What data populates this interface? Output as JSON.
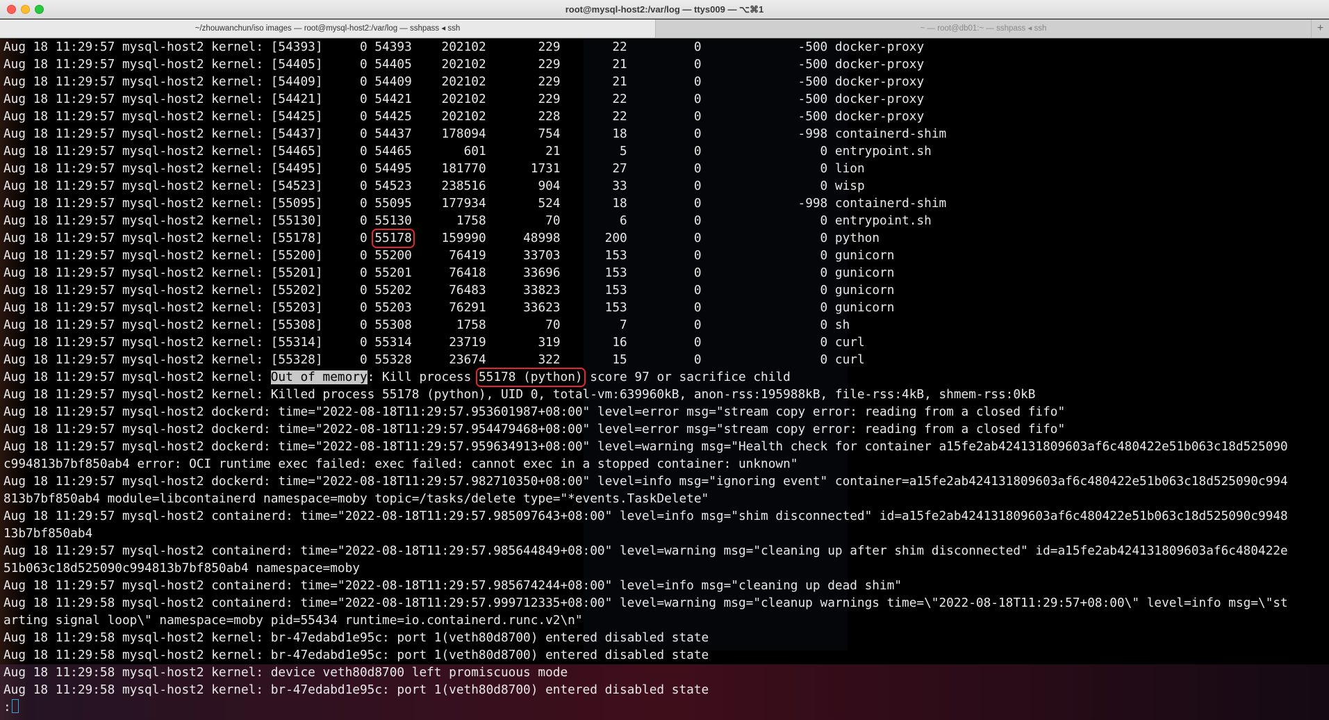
{
  "window": {
    "title": "root@mysql-host2:/var/log — ttys009 — ⌥⌘1"
  },
  "tabs": [
    {
      "label": "~/zhouwanchun/iso images — root@mysql-host2:/var/log — sshpass ◂ ssh",
      "active": true
    },
    {
      "label": "~ — root@db01:~ — sshpass ◂ ssh",
      "active": false
    }
  ],
  "tab_add_label": "+",
  "terminal": {
    "prefix": "Aug 18 11:29:57 mysql-host2 kernel: ",
    "process_rows": [
      {
        "pidtag": "[54393]",
        "uid": "0",
        "tgid": "54393",
        "vm": "202102",
        "rss": "229",
        "pt": "22",
        "swap": "0",
        "adj": "-500",
        "name": "docker-proxy"
      },
      {
        "pidtag": "[54405]",
        "uid": "0",
        "tgid": "54405",
        "vm": "202102",
        "rss": "229",
        "pt": "21",
        "swap": "0",
        "adj": "-500",
        "name": "docker-proxy"
      },
      {
        "pidtag": "[54409]",
        "uid": "0",
        "tgid": "54409",
        "vm": "202102",
        "rss": "229",
        "pt": "21",
        "swap": "0",
        "adj": "-500",
        "name": "docker-proxy"
      },
      {
        "pidtag": "[54421]",
        "uid": "0",
        "tgid": "54421",
        "vm": "202102",
        "rss": "229",
        "pt": "22",
        "swap": "0",
        "adj": "-500",
        "name": "docker-proxy"
      },
      {
        "pidtag": "[54425]",
        "uid": "0",
        "tgid": "54425",
        "vm": "202102",
        "rss": "228",
        "pt": "22",
        "swap": "0",
        "adj": "-500",
        "name": "docker-proxy"
      },
      {
        "pidtag": "[54437]",
        "uid": "0",
        "tgid": "54437",
        "vm": "178094",
        "rss": "754",
        "pt": "18",
        "swap": "0",
        "adj": "-998",
        "name": "containerd-shim"
      },
      {
        "pidtag": "[54465]",
        "uid": "0",
        "tgid": "54465",
        "vm": "601",
        "rss": "21",
        "pt": "5",
        "swap": "0",
        "adj": "0",
        "name": "entrypoint.sh"
      },
      {
        "pidtag": "[54495]",
        "uid": "0",
        "tgid": "54495",
        "vm": "181770",
        "rss": "1731",
        "pt": "27",
        "swap": "0",
        "adj": "0",
        "name": "lion"
      },
      {
        "pidtag": "[54523]",
        "uid": "0",
        "tgid": "54523",
        "vm": "238516",
        "rss": "904",
        "pt": "33",
        "swap": "0",
        "adj": "0",
        "name": "wisp"
      },
      {
        "pidtag": "[55095]",
        "uid": "0",
        "tgid": "55095",
        "vm": "177934",
        "rss": "524",
        "pt": "18",
        "swap": "0",
        "adj": "-998",
        "name": "containerd-shim"
      },
      {
        "pidtag": "[55130]",
        "uid": "0",
        "tgid": "55130",
        "vm": "1758",
        "rss": "70",
        "pt": "6",
        "swap": "0",
        "adj": "0",
        "name": "entrypoint.sh"
      },
      {
        "pidtag": "[55178]",
        "uid": "0",
        "tgid": "55178",
        "vm": "159990",
        "rss": "48998",
        "pt": "200",
        "swap": "0",
        "adj": "0",
        "name": "python",
        "boxed": true
      },
      {
        "pidtag": "[55200]",
        "uid": "0",
        "tgid": "55200",
        "vm": "76419",
        "rss": "33703",
        "pt": "153",
        "swap": "0",
        "adj": "0",
        "name": "gunicorn"
      },
      {
        "pidtag": "[55201]",
        "uid": "0",
        "tgid": "55201",
        "vm": "76418",
        "rss": "33696",
        "pt": "153",
        "swap": "0",
        "adj": "0",
        "name": "gunicorn"
      },
      {
        "pidtag": "[55202]",
        "uid": "0",
        "tgid": "55202",
        "vm": "76483",
        "rss": "33823",
        "pt": "153",
        "swap": "0",
        "adj": "0",
        "name": "gunicorn"
      },
      {
        "pidtag": "[55203]",
        "uid": "0",
        "tgid": "55203",
        "vm": "76291",
        "rss": "33623",
        "pt": "153",
        "swap": "0",
        "adj": "0",
        "name": "gunicorn"
      },
      {
        "pidtag": "[55308]",
        "uid": "0",
        "tgid": "55308",
        "vm": "1758",
        "rss": "70",
        "pt": "7",
        "swap": "0",
        "adj": "0",
        "name": "sh"
      },
      {
        "pidtag": "[55314]",
        "uid": "0",
        "tgid": "55314",
        "vm": "23719",
        "rss": "319",
        "pt": "16",
        "swap": "0",
        "adj": "0",
        "name": "curl"
      },
      {
        "pidtag": "[55328]",
        "uid": "0",
        "tgid": "55328",
        "vm": "23674",
        "rss": "322",
        "pt": "15",
        "swap": "0",
        "adj": "0",
        "name": "curl"
      }
    ],
    "oom_line": {
      "prefix": "Aug 18 11:29:57 mysql-host2 kernel: ",
      "highlight": "Out of memory",
      "mid": ": Kill process ",
      "boxed": "55178 (python)",
      "suffix": " score 97 or sacrifice child"
    },
    "log_lines": [
      "Aug 18 11:29:57 mysql-host2 kernel: Killed process 55178 (python), UID 0, total-vm:639960kB, anon-rss:195988kB, file-rss:4kB, shmem-rss:0kB",
      "Aug 18 11:29:57 mysql-host2 dockerd: time=\"2022-08-18T11:29:57.953601987+08:00\" level=error msg=\"stream copy error: reading from a closed fifo\"",
      "Aug 18 11:29:57 mysql-host2 dockerd: time=\"2022-08-18T11:29:57.954479468+08:00\" level=error msg=\"stream copy error: reading from a closed fifo\"",
      "Aug 18 11:29:57 mysql-host2 dockerd: time=\"2022-08-18T11:29:57.959634913+08:00\" level=warning msg=\"Health check for container a15fe2ab424131809603af6c480422e51b063c18d525090",
      "c994813b7bf850ab4 error: OCI runtime exec failed: exec failed: cannot exec in a stopped container: unknown\"",
      "Aug 18 11:29:57 mysql-host2 dockerd: time=\"2022-08-18T11:29:57.982710350+08:00\" level=info msg=\"ignoring event\" container=a15fe2ab424131809603af6c480422e51b063c18d525090c994",
      "813b7bf850ab4 module=libcontainerd namespace=moby topic=/tasks/delete type=\"*events.TaskDelete\"",
      "Aug 18 11:29:57 mysql-host2 containerd: time=\"2022-08-18T11:29:57.985097643+08:00\" level=info msg=\"shim disconnected\" id=a15fe2ab424131809603af6c480422e51b063c18d525090c9948",
      "13b7bf850ab4",
      "Aug 18 11:29:57 mysql-host2 containerd: time=\"2022-08-18T11:29:57.985644849+08:00\" level=warning msg=\"cleaning up after shim disconnected\" id=a15fe2ab424131809603af6c480422e",
      "51b063c18d525090c994813b7bf850ab4 namespace=moby",
      "Aug 18 11:29:57 mysql-host2 containerd: time=\"2022-08-18T11:29:57.985674244+08:00\" level=info msg=\"cleaning up dead shim\"",
      "Aug 18 11:29:58 mysql-host2 containerd: time=\"2022-08-18T11:29:57.999712335+08:00\" level=warning msg=\"cleanup warnings time=\\\"2022-08-18T11:29:57+08:00\\\" level=info msg=\\\"st",
      "arting signal loop\\\" namespace=moby pid=55434 runtime=io.containerd.runc.v2\\n\"",
      "Aug 18 11:29:58 mysql-host2 kernel: br-47edabd1e95c: port 1(veth80d8700) entered disabled state",
      "Aug 18 11:29:58 mysql-host2 kernel: br-47edabd1e95c: port 1(veth80d8700) entered disabled state",
      "Aug 18 11:29:58 mysql-host2 kernel: device veth80d8700 left promiscuous mode",
      "Aug 18 11:29:58 mysql-host2 kernel: br-47edabd1e95c: port 1(veth80d8700) entered disabled state"
    ],
    "prompt": ":"
  },
  "colors": {
    "terminal_bg": "#000000",
    "text": "#e8e8e8",
    "highlight_box": "#e0262e",
    "cursor": "#3fa3d8"
  }
}
